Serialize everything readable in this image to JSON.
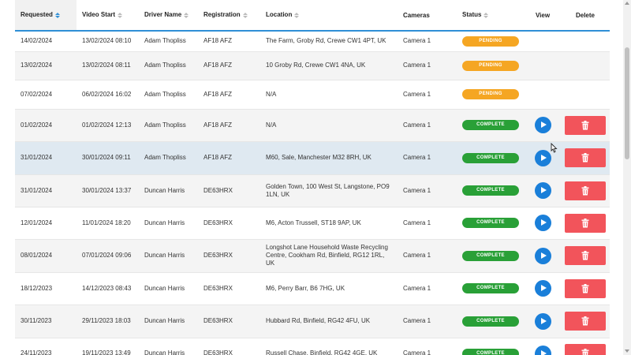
{
  "columns": {
    "requested": "Requested",
    "video_start": "Video Start",
    "driver_name": "Driver Name",
    "registration": "Registration",
    "location": "Location",
    "cameras": "Cameras",
    "status": "Status",
    "view": "View",
    "delete": "Delete"
  },
  "rows": [
    {
      "requested": "14/02/2024",
      "video_start": "13/02/2024 08:10",
      "driver": "Adam Thopliss",
      "registration": "AF18 AFZ",
      "location": "The Farm, Groby Rd, Crewe CW1 4PT, UK",
      "camera": "Camera 1",
      "status": "PENDING"
    },
    {
      "requested": "13/02/2024",
      "video_start": "13/02/2024 08:11",
      "driver": "Adam Thopliss",
      "registration": "AF18 AFZ",
      "location": "10 Groby Rd, Crewe CW1 4NA, UK",
      "camera": "Camera 1",
      "status": "PENDING"
    },
    {
      "requested": "07/02/2024",
      "video_start": "06/02/2024 16:02",
      "driver": "Adam Thopliss",
      "registration": "AF18 AFZ",
      "location": "N/A",
      "camera": "Camera 1",
      "status": "PENDING"
    },
    {
      "requested": "01/02/2024",
      "video_start": "01/02/2024 12:13",
      "driver": "Adam Thopliss",
      "registration": "AF18 AFZ",
      "location": "N/A",
      "camera": "Camera 1",
      "status": "COMPLETE"
    },
    {
      "requested": "31/01/2024",
      "video_start": "30/01/2024 09:11",
      "driver": "Adam Thopliss",
      "registration": "AF18 AFZ",
      "location": "M60, Sale, Manchester M32 8RH, UK",
      "camera": "Camera 1",
      "status": "COMPLETE"
    },
    {
      "requested": "31/01/2024",
      "video_start": "30/01/2024 13:37",
      "driver": "Duncan Harris",
      "registration": "DE63HRX",
      "location": "Golden Town, 100 West St, Langstone, PO9 1LN, UK",
      "camera": "Camera 1",
      "status": "COMPLETE"
    },
    {
      "requested": "12/01/2024",
      "video_start": "11/01/2024 18:20",
      "driver": "Duncan Harris",
      "registration": "DE63HRX",
      "location": "M6, Acton Trussell, ST18 9AP, UK",
      "camera": "Camera 1",
      "status": "COMPLETE"
    },
    {
      "requested": "08/01/2024",
      "video_start": "07/01/2024 09:06",
      "driver": "Duncan Harris",
      "registration": "DE63HRX",
      "location": "Longshot Lane Household Waste Recycling Centre, Cookham Rd, Binfield, RG12 1RL, UK",
      "camera": "Camera 1",
      "status": "COMPLETE"
    },
    {
      "requested": "18/12/2023",
      "video_start": "14/12/2023 08:43",
      "driver": "Duncan Harris",
      "registration": "DE63HRX",
      "location": "M6, Perry Barr, B6 7HG, UK",
      "camera": "Camera 1",
      "status": "COMPLETE"
    },
    {
      "requested": "30/11/2023",
      "video_start": "29/11/2023 18:03",
      "driver": "Duncan Harris",
      "registration": "DE63HRX",
      "location": "Hubbard Rd, Binfield, RG42 4FU, UK",
      "camera": "Camera 1",
      "status": "COMPLETE"
    },
    {
      "requested": "24/11/2023",
      "video_start": "19/11/2023 13:49",
      "driver": "Duncan Harris",
      "registration": "DE63HRX",
      "location": "Russell Chase, Binfield, RG42 4GE, UK",
      "camera": "Camera 1",
      "status": "COMPLETE"
    }
  ],
  "colors": {
    "accent": "#2f8fd6",
    "pending": "#f5a623",
    "complete": "#29a037",
    "play": "#1a7fd9",
    "delete": "#f2545b"
  },
  "icons": {
    "view": "play-icon",
    "delete": "trash-icon",
    "sort": "sort-arrows-icon"
  }
}
